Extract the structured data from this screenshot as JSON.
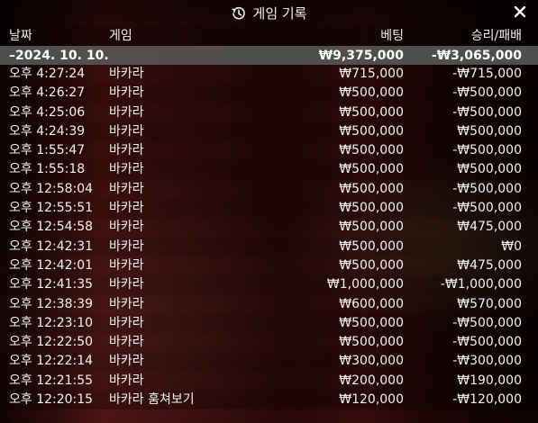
{
  "title": {
    "icon": "history-icon",
    "text": "게임 기록",
    "close_icon": "close-icon"
  },
  "columns": {
    "date": "날짜",
    "game": "게임",
    "bet": "베팅",
    "result": "승리/패배"
  },
  "summary": {
    "date": "–2024. 10. 10.",
    "bet": "₩9,375,000",
    "result": "-₩3,065,000"
  },
  "rows": [
    {
      "time": "오후 4:27:24",
      "game": "바카라",
      "bet": "₩715,000",
      "result": "-₩715,000"
    },
    {
      "time": "오후 4:26:27",
      "game": "바카라",
      "bet": "₩500,000",
      "result": "-₩500,000"
    },
    {
      "time": "오후 4:25:06",
      "game": "바카라",
      "bet": "₩500,000",
      "result": "-₩500,000"
    },
    {
      "time": "오후 4:24:39",
      "game": "바카라",
      "bet": "₩500,000",
      "result": "₩500,000"
    },
    {
      "time": "오후 1:55:47",
      "game": "바카라",
      "bet": "₩500,000",
      "result": "-₩500,000"
    },
    {
      "time": "오후 1:55:18",
      "game": "바카라",
      "bet": "₩500,000",
      "result": "₩500,000"
    },
    {
      "time": "오후 12:58:04",
      "game": "바카라",
      "bet": "₩500,000",
      "result": "-₩500,000"
    },
    {
      "time": "오후 12:55:51",
      "game": "바카라",
      "bet": "₩500,000",
      "result": "-₩500,000"
    },
    {
      "time": "오후 12:54:58",
      "game": "바카라",
      "bet": "₩500,000",
      "result": "₩475,000"
    },
    {
      "time": "오후 12:42:31",
      "game": "바카라",
      "bet": "₩500,000",
      "result": "₩0"
    },
    {
      "time": "오후 12:42:01",
      "game": "바카라",
      "bet": "₩500,000",
      "result": "₩475,000"
    },
    {
      "time": "오후 12:41:35",
      "game": "바카라",
      "bet": "₩1,000,000",
      "result": "-₩1,000,000"
    },
    {
      "time": "오후 12:38:39",
      "game": "바카라",
      "bet": "₩600,000",
      "result": "₩570,000"
    },
    {
      "time": "오후 12:23:10",
      "game": "바카라",
      "bet": "₩500,000",
      "result": "-₩500,000"
    },
    {
      "time": "오후 12:22:50",
      "game": "바카라",
      "bet": "₩500,000",
      "result": "-₩500,000"
    },
    {
      "time": "오후 12:22:14",
      "game": "바카라",
      "bet": "₩300,000",
      "result": "-₩300,000"
    },
    {
      "time": "오후 12:21:55",
      "game": "바카라",
      "bet": "₩200,000",
      "result": "₩190,000"
    },
    {
      "time": "오후 12:20:15",
      "game": "바카라 훔쳐보기",
      "bet": "₩120,000",
      "result": "-₩120,000"
    }
  ],
  "colors": {
    "header_bg": "#000000",
    "summary_bg": "#555555",
    "text": "#f2f2f2"
  }
}
